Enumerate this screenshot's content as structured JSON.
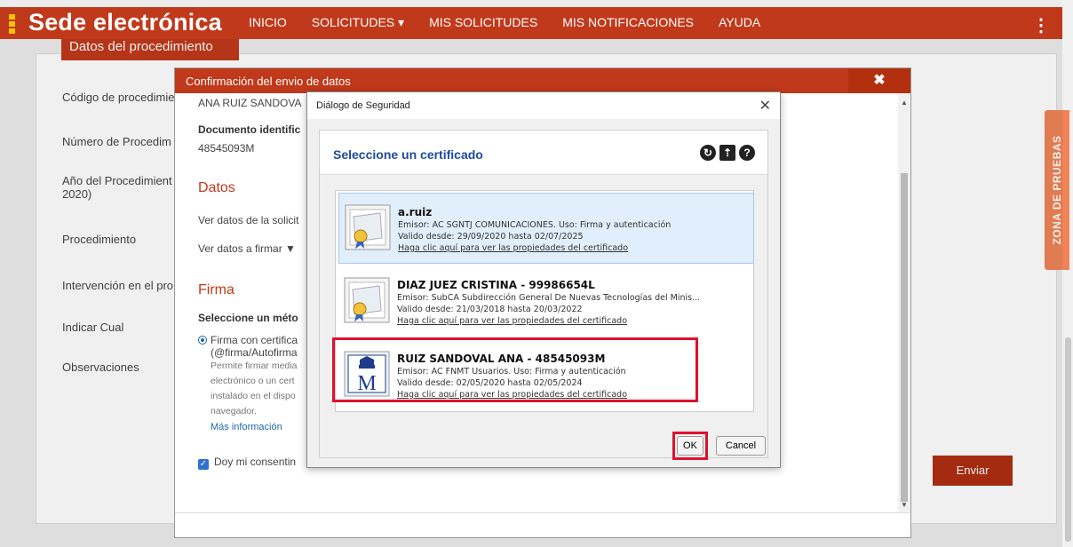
{
  "header": {
    "brand": "Sede electrónica",
    "nav": [
      "INICIO",
      "SOLICITUDES ▾",
      "MIS SOLICITUDES",
      "MIS NOTIFICACIONES",
      "AYUDA"
    ],
    "menu_icon": "⋮",
    "accent": "#c0391a"
  },
  "page": {
    "section_title": "Datos del procedimiento",
    "labels": [
      "Código de procedimie",
      "Número de Procedim",
      "Año del Procedimient",
      "2020)",
      "Procedimiento",
      "Intervención en el pro",
      "Indicar Cual",
      "Observaciones"
    ],
    "send_button": "Enviar",
    "side_tab": "ZONA DE PRUEBAS"
  },
  "confirm_modal": {
    "title": "Confirmación del envio de datos",
    "close_icon": "✖",
    "name": "ANA RUIZ SANDOVA",
    "doc_label": "Documento identific",
    "doc_value": "48545093M",
    "datos_heading": "Datos",
    "ver_datos": "Ver datos de la solicit",
    "ver_firmar": "Ver datos a firmar ▼",
    "firma_heading": "Firma",
    "metodo": "Seleccione un méto",
    "radio_label": "Firma con certifica",
    "radio_sub": "(@firma/Autofirma",
    "desc": [
      "Permite firmar media",
      "electrónico o un cert",
      "instalado en el dispo",
      "navegador."
    ],
    "mas_info": "Más información",
    "consent": "Doy mi consentin"
  },
  "security_dialog": {
    "title": "Diálogo de Seguridad",
    "close_icon": "✕",
    "heading": "Seleccione un certificado",
    "certificates": [
      {
        "name": "a.ruiz",
        "emisor": "Emisor: AC SGNTJ COMUNICACIONES. Uso: Firma y autenticación",
        "valido": "Valido desde: 29/09/2020 hasta 02/07/2025",
        "link": "Haga clic aquí para ver las propiedades del certificado"
      },
      {
        "name": "DIAZ JUEZ CRISTINA - 99986654L",
        "emisor": "Emisor: SubCA Subdirección General De Nuevas Tecnologías del Minis...",
        "valido": "Valido desde: 21/03/2018 hasta 20/03/2022",
        "link": "Haga clic aquí para ver las propiedades del certificado"
      },
      {
        "name": "RUIZ SANDOVAL ANA - 48545093M",
        "emisor": "Emisor: AC FNMT Usuarios. Uso: Firma y autenticación",
        "valido": "Valido desde: 02/05/2020 hasta 02/05/2024",
        "link": "Haga clic aquí para ver las propiedades del certificado"
      }
    ],
    "ok": "OK",
    "cancel": "Cancel",
    "highlight_color": "#e0102e"
  }
}
